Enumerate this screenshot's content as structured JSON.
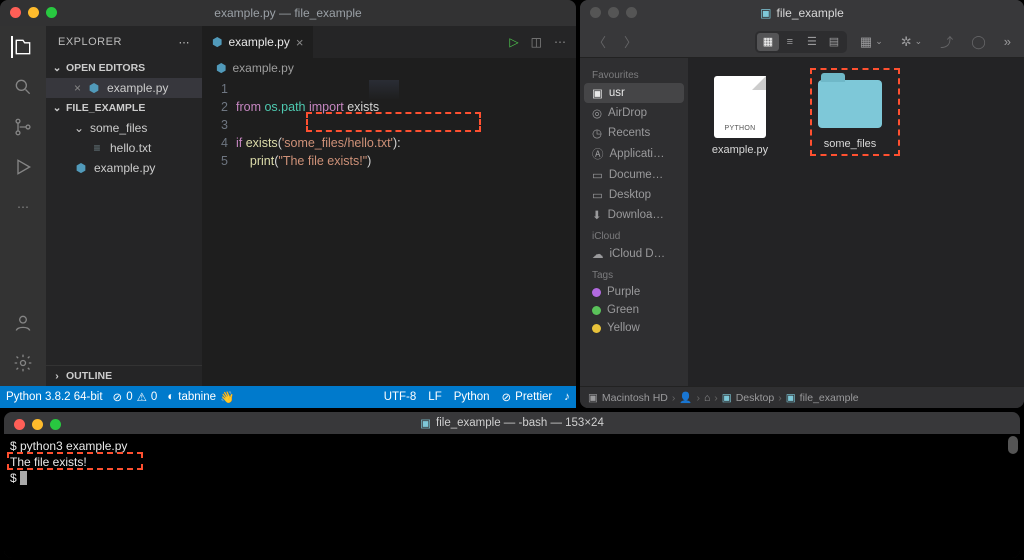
{
  "vscode": {
    "window_title": "example.py — file_example",
    "explorer_label": "EXPLORER",
    "sections": {
      "open_editors": "OPEN EDITORS",
      "folder": "FILE_EXAMPLE",
      "outline": "OUTLINE"
    },
    "open_editors": [
      {
        "name": "example.py",
        "icon": "python"
      }
    ],
    "tree": {
      "folder": "some_files",
      "file_in_folder": "hello.txt",
      "root_file": "example.py"
    },
    "tab": {
      "name": "example.py"
    },
    "breadcrumb": "example.py",
    "code": {
      "l1_from": "from",
      "l1_mod": "os.path",
      "l1_import": "import",
      "l1_name": "exists",
      "l3_if": "if",
      "l3_fn": "exists",
      "l3_lp": "(",
      "l3_str": "'some_files/hello.txt'",
      "l3_rp": "):",
      "l4_fn": "print",
      "l4_lp": "(",
      "l4_str": "\"The file exists!\"",
      "l4_rp": ")"
    },
    "gutter": [
      "1",
      "2",
      "3",
      "4",
      "5"
    ],
    "status": {
      "python": "Python 3.8.2 64-bit",
      "errors": "0",
      "warnings": "0",
      "tabnine": "tabnine",
      "encoding": "UTF-8",
      "eol": "LF",
      "lang": "Python",
      "prettier": "Prettier"
    }
  },
  "finder": {
    "title": "file_example",
    "sidebar": {
      "favourites": "Favourites",
      "items": [
        "usr",
        "AirDrop",
        "Recents",
        "Applicati…",
        "Docume…",
        "Desktop",
        "Downloa…"
      ],
      "icloud_head": "iCloud",
      "icloud_items": [
        "iCloud D…"
      ],
      "tags_head": "Tags",
      "tags": [
        {
          "label": "Purple",
          "color": "#b26ae0"
        },
        {
          "label": "Green",
          "color": "#5ac25a"
        },
        {
          "label": "Yellow",
          "color": "#e8c23a"
        }
      ]
    },
    "files": {
      "example": "example.py",
      "some_files": "some_files"
    },
    "path": [
      "Macintosh HD",
      "",
      "",
      "Desktop",
      "file_example"
    ],
    "path_icons": [
      "disk",
      "chev",
      "user",
      "chev",
      "home",
      "chev",
      "folder",
      "chev",
      "folder"
    ]
  },
  "terminal": {
    "title": "file_example — -bash — 153×24",
    "line1": "$ python3 example.py",
    "line2": "The file exists!",
    "line3": "$ "
  }
}
